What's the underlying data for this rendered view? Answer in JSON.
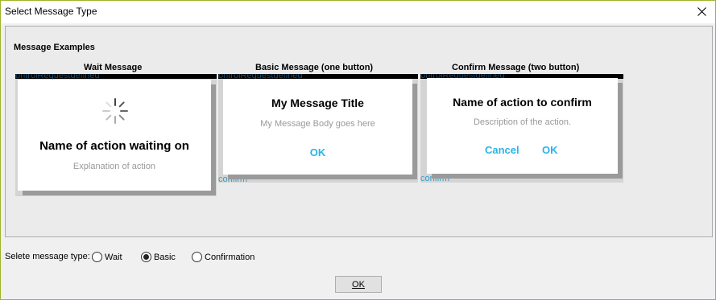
{
  "window": {
    "title": "Select Message Type"
  },
  "panel": {
    "title": "Message Examples"
  },
  "examples": {
    "wait": {
      "label": "Wait Message",
      "dialog_title": "Name of action waiting on",
      "dialog_body": "Explanation of action",
      "bg_text": "ontrolRequestdefined"
    },
    "basic": {
      "label": "Basic Message (one button)",
      "dialog_title": "My Message Title",
      "dialog_body": "My Message Body goes here",
      "button": "OK",
      "bg_text": "ontrolRequestdefined",
      "bg_confirm": "confirm"
    },
    "confirm": {
      "label": "Confirm Message (two button)",
      "dialog_title": "Name of action to confirm",
      "dialog_body": "Description of the action.",
      "cancel_button": "Cancel",
      "ok_button": "OK",
      "bg_text": "ontrolRequestdefined",
      "bg_confirm": "confirm"
    }
  },
  "selector": {
    "label": "Selete message type:",
    "options": [
      "Wait",
      "Basic",
      "Confirmation"
    ],
    "selected": "Basic"
  },
  "ok_button": "OK",
  "colors": {
    "accent": "#28b4e8",
    "window_border": "#9fb42a"
  }
}
